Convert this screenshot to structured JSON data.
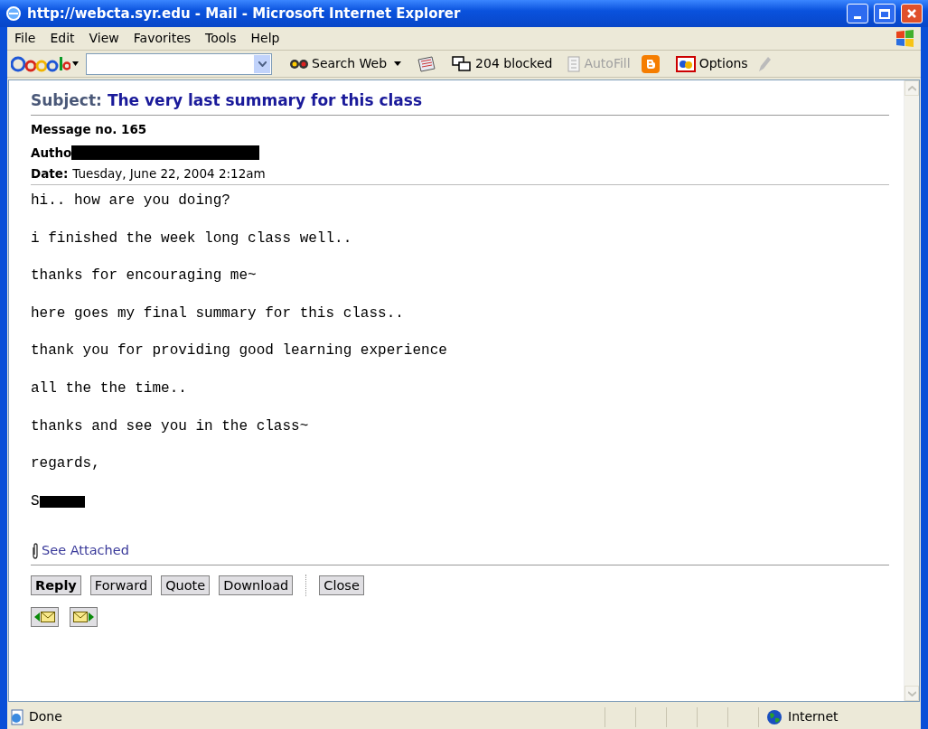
{
  "window": {
    "title": "http://webcta.syr.edu - Mail - Microsoft Internet Explorer"
  },
  "menu": [
    "File",
    "Edit",
    "View",
    "Favorites",
    "Tools",
    "Help"
  ],
  "toolbar": {
    "search_web": "Search Web",
    "blocked": "204 blocked",
    "autofill": "AutoFill",
    "options": "Options"
  },
  "message": {
    "subject_label": "Subject:",
    "subject": "The very last summary for this class",
    "number": "Message no. 165",
    "author_label": "Autho",
    "date_label": "Date:",
    "date": "Tuesday, June 22, 2004 2:12am",
    "body": [
      "hi.. how are you doing?",
      "i finished the week long class well..",
      "thanks for encouraging me~",
      "here goes my final summary for this class..",
      "thank you for providing good learning experience",
      "all the the time..",
      "thanks and see you in the class~",
      "regards,",
      "S"
    ],
    "attachment": "See Attached",
    "buttons": [
      {
        "label": "Reply",
        "bold": true
      },
      {
        "label": "Forward",
        "bold": false
      },
      {
        "label": "Quote",
        "bold": false
      },
      {
        "label": "Download",
        "bold": false
      },
      {
        "label": "Close",
        "bold": false
      }
    ]
  },
  "status_bar": {
    "status": "Done",
    "zone": "Internet"
  }
}
